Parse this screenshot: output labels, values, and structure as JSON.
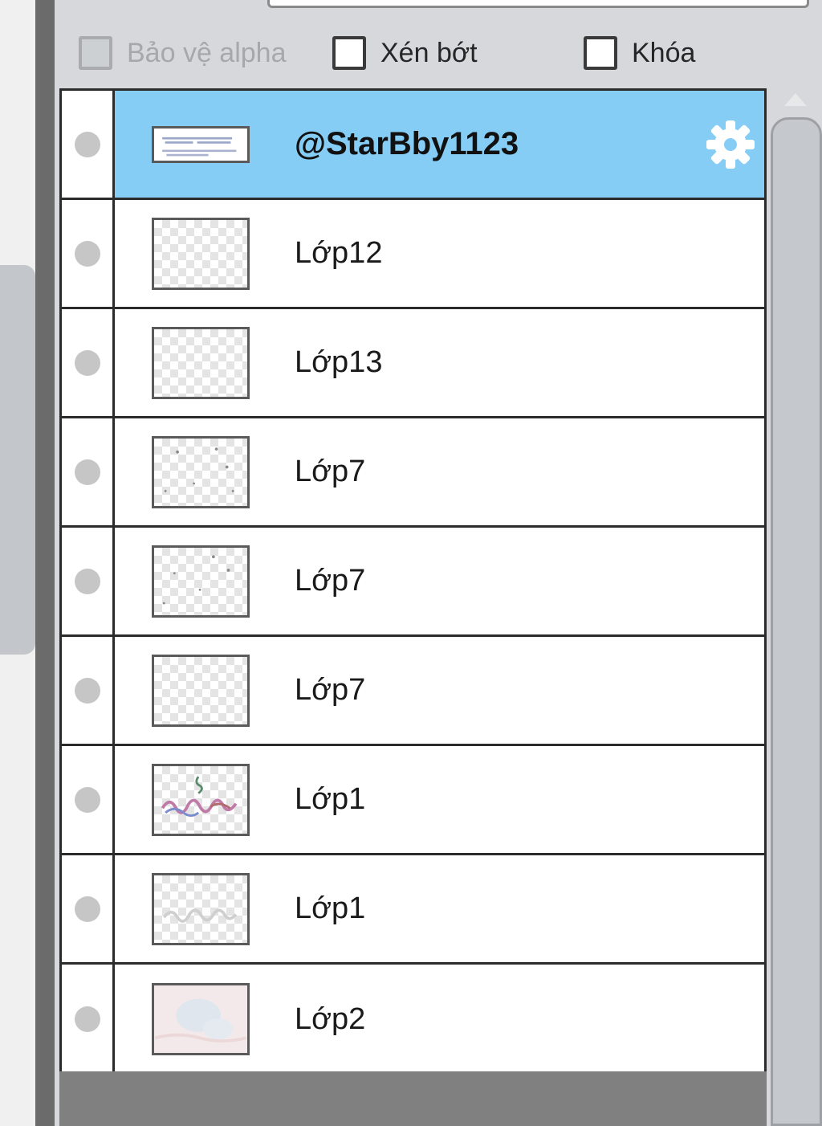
{
  "options": {
    "protect_alpha": {
      "label": "Bảo vệ alpha",
      "checked": false,
      "disabled": true
    },
    "clipping": {
      "label": "Xén bớt",
      "checked": false
    },
    "lock": {
      "label": "Khóa",
      "checked": false
    }
  },
  "layers": [
    {
      "name": "@StarBby1123",
      "selected": true,
      "thumbnail": "text-layer",
      "settings_icon": "gear-icon"
    },
    {
      "name": "Lớp12",
      "selected": false,
      "thumbnail": "transparent"
    },
    {
      "name": "Lớp13",
      "selected": false,
      "thumbnail": "transparent"
    },
    {
      "name": "Lớp7",
      "selected": false,
      "thumbnail": "sparse-dots"
    },
    {
      "name": "Lớp7",
      "selected": false,
      "thumbnail": "sparse-dots"
    },
    {
      "name": "Lớp7",
      "selected": false,
      "thumbnail": "transparent"
    },
    {
      "name": "Lớp1",
      "selected": false,
      "thumbnail": "colored-lettering"
    },
    {
      "name": "Lớp1",
      "selected": false,
      "thumbnail": "faint-lettering"
    },
    {
      "name": "Lớp2",
      "selected": false,
      "thumbnail": "pale-painting"
    }
  ],
  "colors": {
    "selected_row": "#86cdf5",
    "panel_bg": "#d6d8db",
    "border": "#2b2b2b"
  }
}
